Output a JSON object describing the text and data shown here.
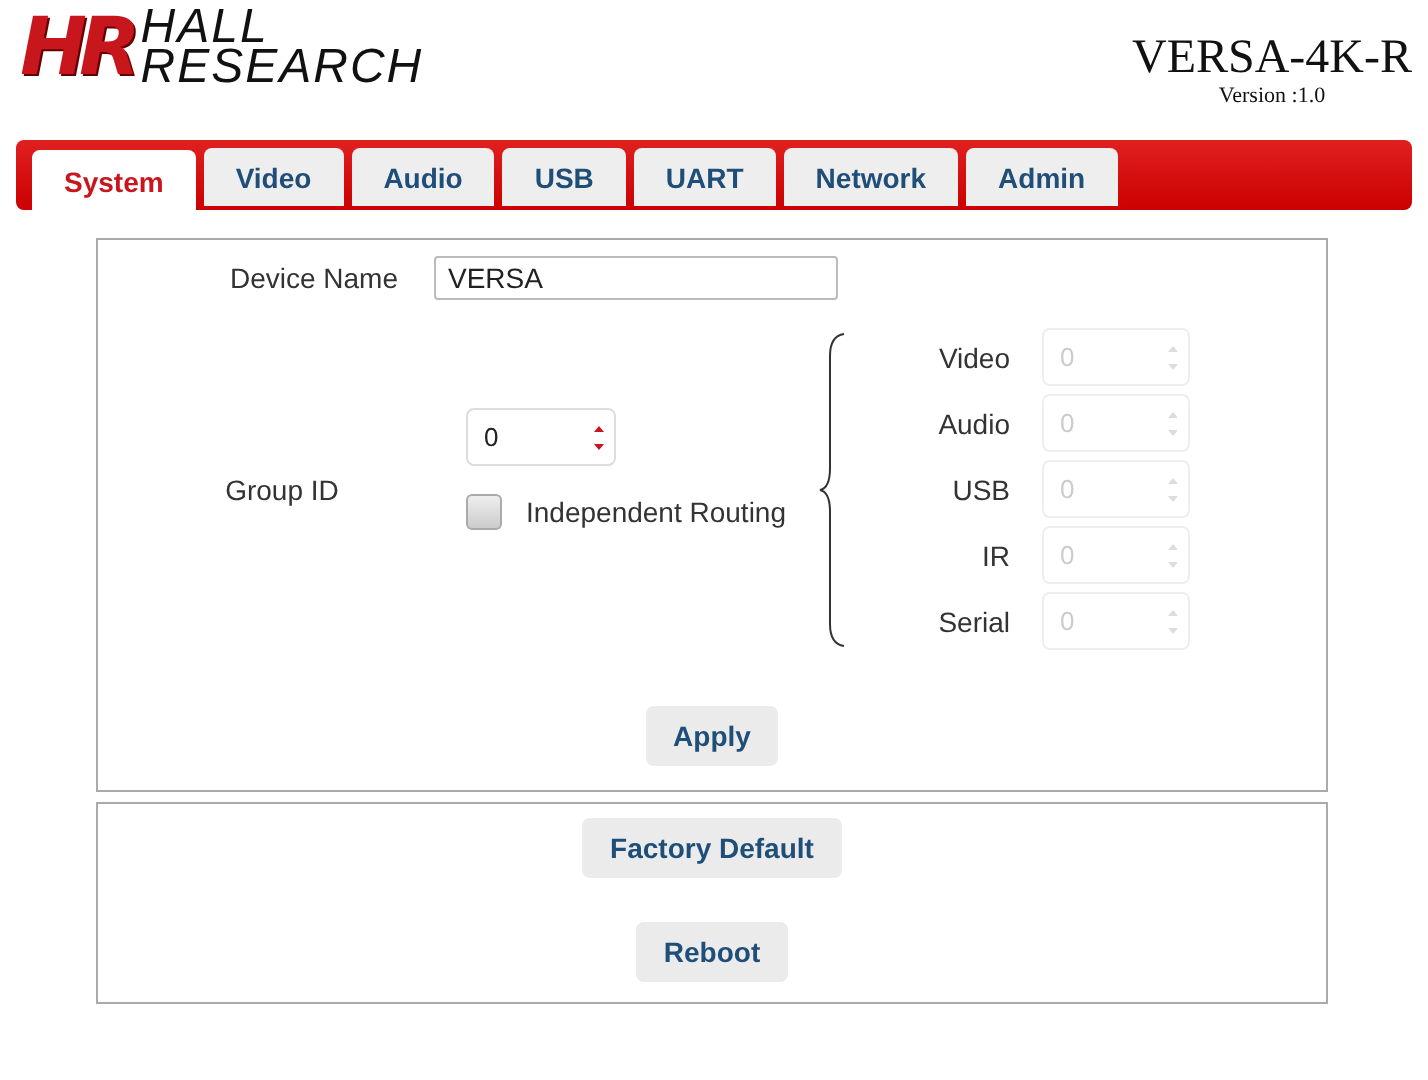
{
  "header": {
    "logo_mark": "HR",
    "logo_line_1": "HALL",
    "logo_line_2": "RESEARCH",
    "product": "VERSA-4K-R",
    "version": "Version :1.0"
  },
  "tabs": [
    {
      "label": "System",
      "selected": true
    },
    {
      "label": "Video",
      "selected": false
    },
    {
      "label": "Audio",
      "selected": false
    },
    {
      "label": "USB",
      "selected": false
    },
    {
      "label": "UART",
      "selected": false
    },
    {
      "label": "Network",
      "selected": false
    },
    {
      "label": "Admin",
      "selected": false
    }
  ],
  "device_name": {
    "label": "Device Name",
    "value": "VERSA"
  },
  "group_id": {
    "label": "Group ID",
    "value": "0"
  },
  "independent_routing": {
    "label": "Independent Routing",
    "checked": false
  },
  "routes": [
    {
      "label": "Video",
      "value": "0",
      "disabled": true
    },
    {
      "label": "Audio",
      "value": "0",
      "disabled": true
    },
    {
      "label": "USB",
      "value": "0",
      "disabled": true
    },
    {
      "label": "IR",
      "value": "0",
      "disabled": true
    },
    {
      "label": "Serial",
      "value": "0",
      "disabled": true
    }
  ],
  "apply_button": "Apply",
  "system_buttons": [
    "Factory Default",
    "Reboot"
  ]
}
